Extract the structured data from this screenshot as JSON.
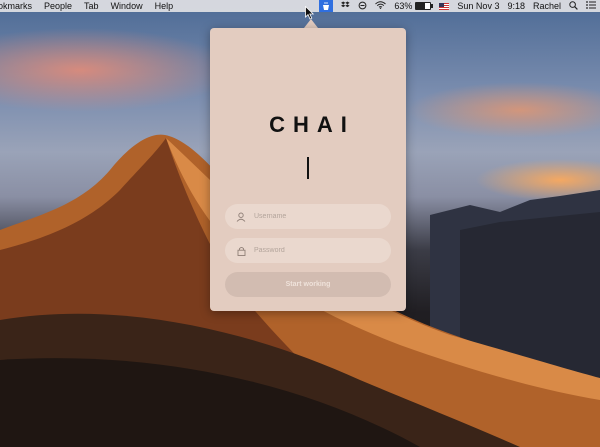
{
  "menubar": {
    "items": [
      "okmarks",
      "People",
      "Tab",
      "Window",
      "Help"
    ],
    "tray": {
      "chai_icon": "chai-tray-icon",
      "battery_percent": "63%",
      "battery_level": 0.63,
      "date": "Sun Nov 3",
      "time": "9:18",
      "user": "Rachel"
    }
  },
  "popover": {
    "app_title": "CHAI",
    "username": {
      "placeholder": "Username",
      "value": ""
    },
    "password": {
      "placeholder": "Password",
      "value": ""
    },
    "start_button": "Start working"
  },
  "colors": {
    "popover_bg": "#e3ccc0",
    "field_bg": "#ead8ce",
    "button_bg": "#d2bcb1",
    "tray_highlight": "#2f6fe0"
  }
}
